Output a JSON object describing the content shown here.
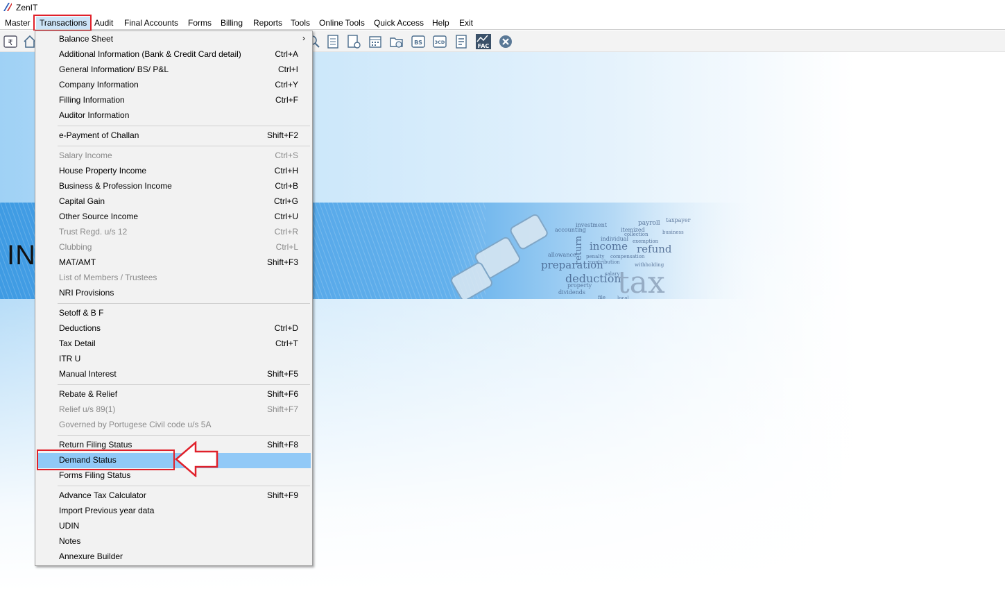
{
  "window": {
    "title": "ZenIT"
  },
  "menubar": {
    "items": [
      "Master",
      "Transactions",
      "Audit",
      "Final Accounts",
      "Forms",
      "Billing",
      "Reports",
      "Tools",
      "Online Tools",
      "Quick Access",
      "Help",
      "Exit"
    ],
    "active": "Transactions"
  },
  "toolbar": {
    "icons": [
      "rupee-book-icon",
      "home-icon",
      "search-icon",
      "report-icon",
      "user-report-icon",
      "calendar-icon",
      "folder-icon",
      "bs-icon",
      "3cd-icon",
      "form-icon",
      "fac-icon",
      "close-icon"
    ],
    "labels": {
      "bs": "BS",
      "cd": "3CD",
      "fac": "FAC"
    }
  },
  "banner": {
    "title": "INC",
    "words": [
      "payroll",
      "taxpayer",
      "investment",
      "itemized",
      "accounting",
      "income",
      "refund",
      "preparation",
      "deduction",
      "tax",
      "penalty",
      "compensation",
      "dividends",
      "salary",
      "property",
      "local",
      "file",
      "return",
      "allowance",
      "individual",
      "exemption",
      "collection",
      "business",
      "contribution",
      "withholding"
    ]
  },
  "dropdown": {
    "items": [
      {
        "label": "Balance Sheet",
        "shortcut": "",
        "submenu": true
      },
      {
        "label": "Additional Information (Bank & Credit Card detail)",
        "shortcut": "Ctrl+A"
      },
      {
        "label": "General Information/ BS/ P&L",
        "shortcut": "Ctrl+I"
      },
      {
        "label": "Company Information",
        "shortcut": "Ctrl+Y"
      },
      {
        "label": "Filling Information",
        "shortcut": "Ctrl+F"
      },
      {
        "label": "Auditor Information",
        "shortcut": ""
      },
      {
        "label": "e-Payment of Challan",
        "shortcut": "Shift+F2"
      },
      {
        "label": "Salary Income",
        "shortcut": "Ctrl+S",
        "disabled": true
      },
      {
        "label": "House Property Income",
        "shortcut": "Ctrl+H"
      },
      {
        "label": "Business & Profession Income",
        "shortcut": "Ctrl+B"
      },
      {
        "label": "Capital Gain",
        "shortcut": "Ctrl+G"
      },
      {
        "label": "Other Source Income",
        "shortcut": "Ctrl+U"
      },
      {
        "label": "Trust Regd. u/s 12",
        "shortcut": "Ctrl+R",
        "disabled": true
      },
      {
        "label": "Clubbing",
        "shortcut": "Ctrl+L",
        "disabled": true
      },
      {
        "label": "MAT/AMT",
        "shortcut": "Shift+F3"
      },
      {
        "label": "List of Members / Trustees",
        "shortcut": "",
        "disabled": true
      },
      {
        "label": "NRI Provisions",
        "shortcut": ""
      },
      {
        "label": "Setoff & B F",
        "shortcut": ""
      },
      {
        "label": "Deductions",
        "shortcut": "Ctrl+D"
      },
      {
        "label": "Tax Detail",
        "shortcut": "Ctrl+T"
      },
      {
        "label": "ITR U",
        "shortcut": ""
      },
      {
        "label": "Manual Interest",
        "shortcut": "Shift+F5"
      },
      {
        "label": "Rebate & Relief",
        "shortcut": "Shift+F6"
      },
      {
        "label": "Relief u/s 89(1)",
        "shortcut": "Shift+F7",
        "disabled": true
      },
      {
        "label": "Governed by Portugese Civil code u/s 5A",
        "shortcut": "",
        "disabled": true
      },
      {
        "label": "Return Filing Status",
        "shortcut": "Shift+F8"
      },
      {
        "label": "Demand Status",
        "shortcut": "",
        "highlighted": true
      },
      {
        "label": "Forms Filing Status",
        "shortcut": ""
      },
      {
        "label": "Advance Tax Calculator",
        "shortcut": "Shift+F9"
      },
      {
        "label": "Import Previous year data",
        "shortcut": ""
      },
      {
        "label": "UDIN",
        "shortcut": ""
      },
      {
        "label": "Notes",
        "shortcut": ""
      },
      {
        "label": "Annexure Builder",
        "shortcut": ""
      }
    ]
  },
  "colors": {
    "highlight": "#91c9f7",
    "annotation": "#e0202a",
    "menu_bg": "#f2f2f2",
    "disabled_text": "#8a8a8a"
  }
}
